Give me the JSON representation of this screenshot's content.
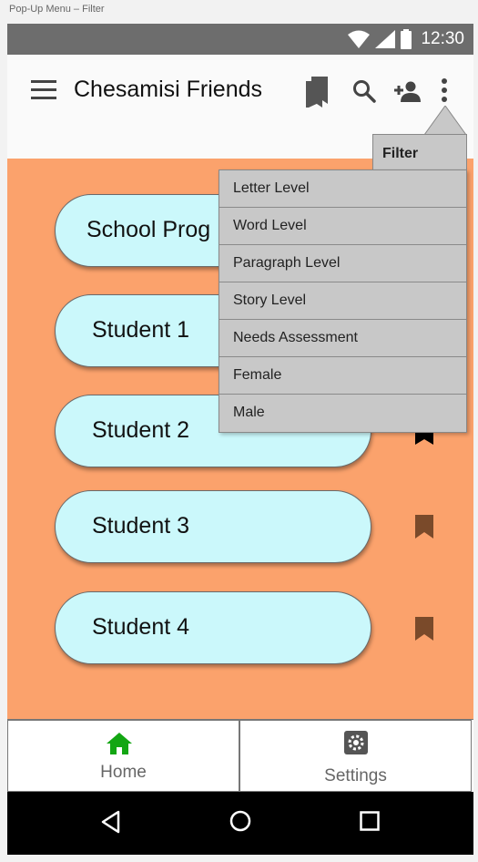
{
  "frame": {
    "label": "Pop-Up Menu – Filter"
  },
  "status_bar": {
    "time": "12:30",
    "icons": [
      "wifi-icon",
      "cell-signal-icon",
      "battery-icon"
    ]
  },
  "app_bar": {
    "title": "Chesamisi Friends",
    "actions": [
      "bookmarks-icon",
      "search-icon",
      "add-person-icon",
      "more-vert-icon"
    ]
  },
  "list": {
    "items": [
      {
        "label": "School Prog",
        "bookmark": "none"
      },
      {
        "label": "Student 1",
        "bookmark": "none"
      },
      {
        "label": "Student 2",
        "bookmark": "black"
      },
      {
        "label": "Student 3",
        "bookmark": "brown"
      },
      {
        "label": "Student 4",
        "bookmark": "brown"
      }
    ]
  },
  "filter_menu": {
    "title": "Filter",
    "items": [
      "Letter Level",
      "Word Level",
      "Paragraph Level",
      "Story Level",
      "Needs Assessment",
      "Female",
      "Male"
    ]
  },
  "bottom_nav": {
    "items": [
      {
        "label": "Home",
        "icon": "home-icon",
        "active": true
      },
      {
        "label": "Settings",
        "icon": "settings-gear-icon",
        "active": false
      }
    ]
  },
  "system_nav": {
    "buttons": [
      "back-icon",
      "home-circle-icon",
      "overview-square-icon"
    ]
  },
  "colors": {
    "status_bar": "#6d6d6d",
    "content_bg": "#fba26c",
    "pill_bg": "#cbf8fb",
    "menu_bg": "#c8c8c8",
    "home_active": "#13a613",
    "bookmark_brown": "#7a4a2a",
    "bookmark_black": "#000000"
  }
}
